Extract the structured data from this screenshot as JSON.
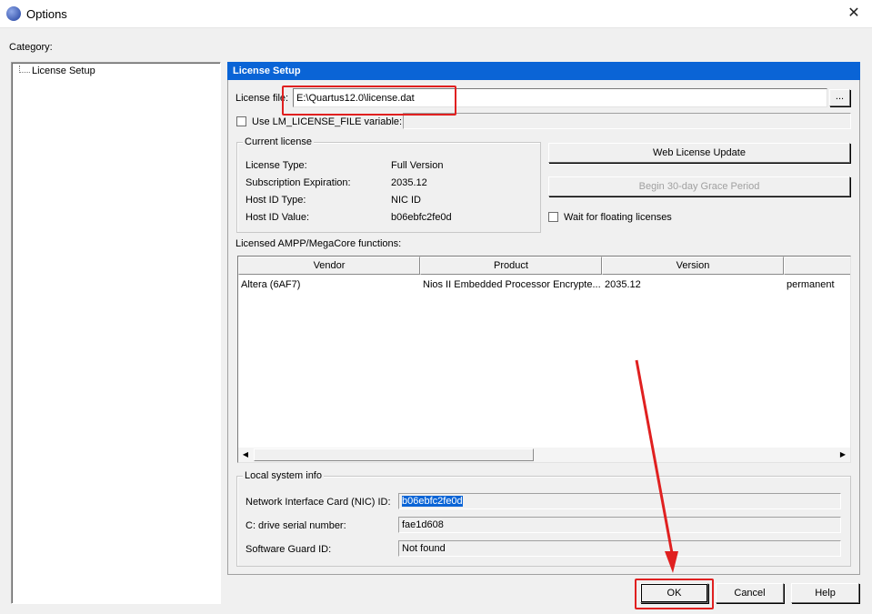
{
  "window": {
    "title": "Options",
    "close_glyph": "✕",
    "icon": "quartus-icon"
  },
  "category": {
    "label": "Category:",
    "items": [
      {
        "label": "License Setup"
      }
    ]
  },
  "panel": {
    "header": "License Setup",
    "license_file": {
      "label": "License file:",
      "value": "E:\\Quartus12.0\\license.dat",
      "browse_label": "..."
    },
    "use_lm_license": {
      "label": "Use LM_LICENSE_FILE variable:",
      "checked": false,
      "value": ""
    },
    "current_license": {
      "title": "Current license",
      "rows": [
        {
          "label": "License Type:",
          "value": "Full Version"
        },
        {
          "label": "Subscription Expiration:",
          "value": "2035.12"
        },
        {
          "label": "Host ID Type:",
          "value": "NIC ID"
        },
        {
          "label": "Host ID Value:",
          "value": "b06ebfc2fe0d"
        }
      ]
    },
    "web_license_update_label": "Web License Update",
    "grace_period_label": "Begin 30-day Grace Period",
    "wait_floating": {
      "label": "Wait for floating licenses",
      "checked": false
    },
    "ampp": {
      "label": "Licensed AMPP/MegaCore functions:",
      "columns": [
        "Vendor",
        "Product",
        "Version",
        ""
      ],
      "rows": [
        {
          "vendor": "Altera (6AF7)",
          "product": "Nios II Embedded Processor Encrypte...",
          "version": "2035.12",
          "expiration": "permanent"
        }
      ]
    },
    "local_system": {
      "title": "Local system info",
      "nic_label": "Network Interface Card (NIC) ID:",
      "nic_value": "b06ebfc2fe0d",
      "serial_label": "C: drive serial number:",
      "serial_value": "fae1d608",
      "guard_label": "Software Guard ID:",
      "guard_value": "Not found"
    }
  },
  "buttons": {
    "ok": "OK",
    "cancel": "Cancel",
    "help": "Help"
  },
  "colors": {
    "header_blue": "#0a64d6",
    "annotation_red": "#e02020",
    "dialog_bg": "#f0f0f0"
  }
}
